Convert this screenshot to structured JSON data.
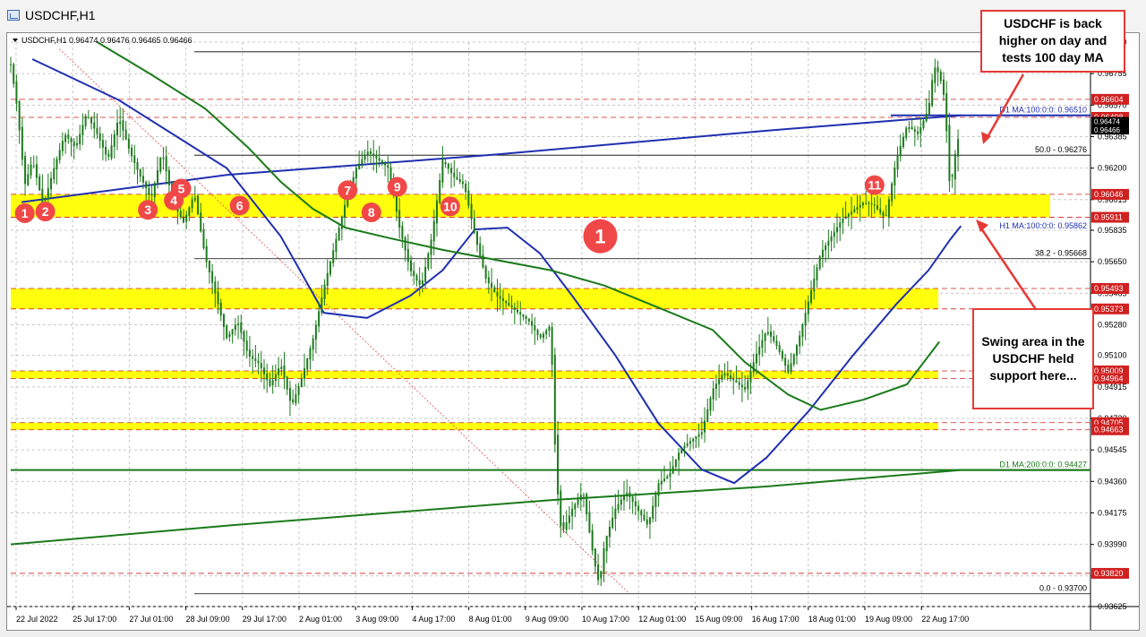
{
  "window": {
    "title": "USDCHF,H1"
  },
  "chart_header": "USDCHF,H1  0.96474 0.96476 0.96465 0.96466",
  "annotations": {
    "top_right": "USDCHF is back higher on day and tests 100 day MA",
    "bottom_right": "Swing area in the USDCHF held support here..."
  },
  "colors": {
    "zone_fill": "#ffff00",
    "ma100_color": "#1f2fb0",
    "ma200_color": "#1a7a1a",
    "candle_color": "#1d7a1d",
    "marker_color": "#f04848"
  },
  "chart_data": {
    "type": "candlestick",
    "symbol": "USDCHF",
    "timeframe": "H1",
    "ohlc_readout": {
      "open": 0.96474,
      "high": 0.96476,
      "low": 0.96465,
      "close": 0.96466
    },
    "ylim": [
      0.93625,
      0.9694
    ],
    "y_ticks": [
      0.9694,
      0.96755,
      0.9657,
      0.96385,
      0.962,
      0.96015,
      0.95835,
      0.9565,
      0.95465,
      0.9528,
      0.951,
      0.94915,
      0.9473,
      0.94545,
      0.9436,
      0.94175,
      0.9399,
      0.93805,
      0.93625
    ],
    "x_ticks": [
      "22 Jul 2022",
      "25 Jul 17:00",
      "27 Jul 01:00",
      "28 Jul 09:00",
      "29 Jul 17:00",
      "2 Aug 01:00",
      "3 Aug 09:00",
      "4 Aug 17:00",
      "8 Aug 01:00",
      "9 Aug 09:00",
      "10 Aug 17:00",
      "12 Aug 01:00",
      "15 Aug 09:00",
      "16 Aug 17:00",
      "18 Aug 01:00",
      "19 Aug 09:00",
      "22 Aug 17:00"
    ],
    "horizontal_levels": [
      {
        "label": "61.8 - 0.96883",
        "value": 0.96883,
        "style": "solid"
      },
      {
        "label": "",
        "value": 0.96604,
        "style": "dashed-red",
        "price_tag": "0.96604"
      },
      {
        "label": "D1 MA:100:0:0: 0.96510",
        "value": 0.9651,
        "style": "ma100"
      },
      {
        "label": "",
        "value": 0.96498,
        "style": "dashed-red",
        "price_tag": "0.96498"
      },
      {
        "label": "50.0 - 0.96276",
        "value": 0.96276,
        "style": "solid"
      },
      {
        "label": "",
        "value": 0.96046,
        "style": "dashed-red",
        "price_tag": "0.96046"
      },
      {
        "label": "H1 MA:100:0:0: 0.95862",
        "value": 0.95862,
        "style": "ma-h1"
      },
      {
        "label": "",
        "value": 0.95911,
        "style": "dashed-red",
        "price_tag": "0.95911"
      },
      {
        "label": "38.2 - 0.95668",
        "value": 0.95668,
        "style": "solid"
      },
      {
        "label": "",
        "value": 0.95493,
        "style": "dashed-red",
        "price_tag": "0.95493"
      },
      {
        "label": "",
        "value": 0.95373,
        "style": "dashed-red",
        "price_tag": "0.95373"
      },
      {
        "label": "",
        "value": 0.95009,
        "style": "dashed-red",
        "price_tag": "0.95009"
      },
      {
        "label": "",
        "value": 0.94964,
        "style": "dashed-red",
        "price_tag": "0.94964"
      },
      {
        "label": "",
        "value": 0.94705,
        "style": "dashed-red",
        "price_tag": "0.94705"
      },
      {
        "label": "",
        "value": 0.94663,
        "style": "dashed-red",
        "price_tag": "0.94663"
      },
      {
        "label": "D1 MA:200:0:0: 0.94427",
        "value": 0.94427,
        "style": "ma200"
      },
      {
        "label": "",
        "value": 0.9382,
        "style": "dashed-red",
        "price_tag": "0.93820"
      },
      {
        "label": "0.0 - 0.93700",
        "value": 0.937,
        "style": "solid"
      }
    ],
    "current_price_tags": [
      "0.96474",
      "0.96466"
    ],
    "zones": [
      {
        "from": 0.95911,
        "to": 0.96046
      },
      {
        "from": 0.95373,
        "to": 0.95493
      },
      {
        "from": 0.94964,
        "to": 0.95009
      },
      {
        "from": 0.94663,
        "to": 0.94705
      }
    ],
    "markers": [
      {
        "label": "1",
        "x": 0.013,
        "y": 0.95935,
        "size": "small"
      },
      {
        "label": "2",
        "x": 0.032,
        "y": 0.95945,
        "size": "small"
      },
      {
        "label": "3",
        "x": 0.127,
        "y": 0.95955,
        "size": "small"
      },
      {
        "label": "4",
        "x": 0.151,
        "y": 0.9601,
        "size": "small"
      },
      {
        "label": "5",
        "x": 0.158,
        "y": 0.9608,
        "size": "small"
      },
      {
        "label": "6",
        "x": 0.212,
        "y": 0.9598,
        "size": "small"
      },
      {
        "label": "7",
        "x": 0.312,
        "y": 0.9607,
        "size": "small"
      },
      {
        "label": "8",
        "x": 0.334,
        "y": 0.9594,
        "size": "small"
      },
      {
        "label": "9",
        "x": 0.358,
        "y": 0.9609,
        "size": "small"
      },
      {
        "label": "10",
        "x": 0.407,
        "y": 0.95975,
        "size": "small"
      },
      {
        "label": "1",
        "x": 0.546,
        "y": 0.958,
        "size": "large"
      },
      {
        "label": "11",
        "x": 0.8,
        "y": 0.961,
        "size": "small"
      }
    ],
    "close_path": [
      [
        0,
        0.9681
      ],
      [
        0.006,
        0.9655
      ],
      [
        0.013,
        0.961
      ],
      [
        0.02,
        0.9625
      ],
      [
        0.03,
        0.9598
      ],
      [
        0.04,
        0.962
      ],
      [
        0.05,
        0.964
      ],
      [
        0.06,
        0.9632
      ],
      [
        0.07,
        0.9652
      ],
      [
        0.08,
        0.964
      ],
      [
        0.09,
        0.9625
      ],
      [
        0.1,
        0.965
      ],
      [
        0.11,
        0.963
      ],
      [
        0.12,
        0.9615
      ],
      [
        0.13,
        0.9602
      ],
      [
        0.14,
        0.963
      ],
      [
        0.15,
        0.96
      ],
      [
        0.16,
        0.9588
      ],
      [
        0.17,
        0.9605
      ],
      [
        0.18,
        0.9568
      ],
      [
        0.19,
        0.9545
      ],
      [
        0.2,
        0.952
      ],
      [
        0.21,
        0.953
      ],
      [
        0.22,
        0.951
      ],
      [
        0.23,
        0.9505
      ],
      [
        0.24,
        0.9492
      ],
      [
        0.25,
        0.9505
      ],
      [
        0.26,
        0.948
      ],
      [
        0.27,
        0.9498
      ],
      [
        0.28,
        0.952
      ],
      [
        0.29,
        0.955
      ],
      [
        0.3,
        0.9575
      ],
      [
        0.31,
        0.96
      ],
      [
        0.32,
        0.962
      ],
      [
        0.33,
        0.963
      ],
      [
        0.34,
        0.9625
      ],
      [
        0.35,
        0.962
      ],
      [
        0.36,
        0.9585
      ],
      [
        0.37,
        0.956
      ],
      [
        0.38,
        0.955
      ],
      [
        0.39,
        0.958
      ],
      [
        0.4,
        0.9625
      ],
      [
        0.41,
        0.9615
      ],
      [
        0.42,
        0.961
      ],
      [
        0.43,
        0.958
      ],
      [
        0.44,
        0.9555
      ],
      [
        0.45,
        0.9545
      ],
      [
        0.46,
        0.954
      ],
      [
        0.47,
        0.9535
      ],
      [
        0.48,
        0.953
      ],
      [
        0.49,
        0.952
      ],
      [
        0.5,
        0.9528
      ],
      [
        0.505,
        0.944
      ],
      [
        0.51,
        0.9405
      ],
      [
        0.52,
        0.942
      ],
      [
        0.53,
        0.943
      ],
      [
        0.54,
        0.939
      ],
      [
        0.545,
        0.9375
      ],
      [
        0.55,
        0.94
      ],
      [
        0.56,
        0.942
      ],
      [
        0.57,
        0.943
      ],
      [
        0.58,
        0.942
      ],
      [
        0.59,
        0.941
      ],
      [
        0.6,
        0.9435
      ],
      [
        0.61,
        0.944
      ],
      [
        0.62,
        0.9455
      ],
      [
        0.63,
        0.946
      ],
      [
        0.64,
        0.9465
      ],
      [
        0.65,
        0.949
      ],
      [
        0.66,
        0.95
      ],
      [
        0.67,
        0.9495
      ],
      [
        0.68,
        0.949
      ],
      [
        0.69,
        0.951
      ],
      [
        0.7,
        0.9525
      ],
      [
        0.71,
        0.9515
      ],
      [
        0.72,
        0.95
      ],
      [
        0.73,
        0.952
      ],
      [
        0.74,
        0.9545
      ],
      [
        0.75,
        0.957
      ],
      [
        0.76,
        0.958
      ],
      [
        0.77,
        0.959
      ],
      [
        0.78,
        0.9595
      ],
      [
        0.79,
        0.96
      ],
      [
        0.8,
        0.9598
      ],
      [
        0.81,
        0.959
      ],
      [
        0.82,
        0.9625
      ],
      [
        0.83,
        0.9645
      ],
      [
        0.84,
        0.964
      ],
      [
        0.85,
        0.9655
      ],
      [
        0.855,
        0.968
      ],
      [
        0.86,
        0.9675
      ],
      [
        0.865,
        0.966
      ],
      [
        0.87,
        0.9605
      ],
      [
        0.875,
        0.963
      ],
      [
        0.88,
        0.9645
      ]
    ],
    "ma_100_h1": [
      [
        0.02,
        0.9684
      ],
      [
        0.1,
        0.966
      ],
      [
        0.2,
        0.962
      ],
      [
        0.25,
        0.958
      ],
      [
        0.29,
        0.9535
      ],
      [
        0.33,
        0.9532
      ],
      [
        0.37,
        0.9545
      ],
      [
        0.4,
        0.956
      ],
      [
        0.43,
        0.9584
      ],
      [
        0.46,
        0.9585
      ],
      [
        0.49,
        0.957
      ],
      [
        0.52,
        0.9545
      ],
      [
        0.56,
        0.951
      ],
      [
        0.6,
        0.947
      ],
      [
        0.64,
        0.9443
      ],
      [
        0.67,
        0.9435
      ],
      [
        0.7,
        0.945
      ],
      [
        0.74,
        0.9478
      ],
      [
        0.78,
        0.951
      ],
      [
        0.82,
        0.954
      ],
      [
        0.85,
        0.956
      ],
      [
        0.87,
        0.9578
      ],
      [
        0.88,
        0.9586
      ]
    ],
    "ma_200_h1": [
      [
        0.08,
        0.9694
      ],
      [
        0.13,
        0.9675
      ],
      [
        0.18,
        0.9655
      ],
      [
        0.22,
        0.9632
      ],
      [
        0.25,
        0.9612
      ],
      [
        0.28,
        0.9596
      ],
      [
        0.31,
        0.9585
      ],
      [
        0.35,
        0.9579
      ],
      [
        0.4,
        0.9572
      ],
      [
        0.45,
        0.9566
      ],
      [
        0.5,
        0.956
      ],
      [
        0.55,
        0.9551
      ],
      [
        0.6,
        0.9538
      ],
      [
        0.65,
        0.9525
      ],
      [
        0.68,
        0.9506
      ],
      [
        0.72,
        0.9487
      ],
      [
        0.75,
        0.9478
      ],
      [
        0.79,
        0.9484
      ],
      [
        0.83,
        0.9493
      ],
      [
        0.86,
        0.9518
      ]
    ]
  }
}
